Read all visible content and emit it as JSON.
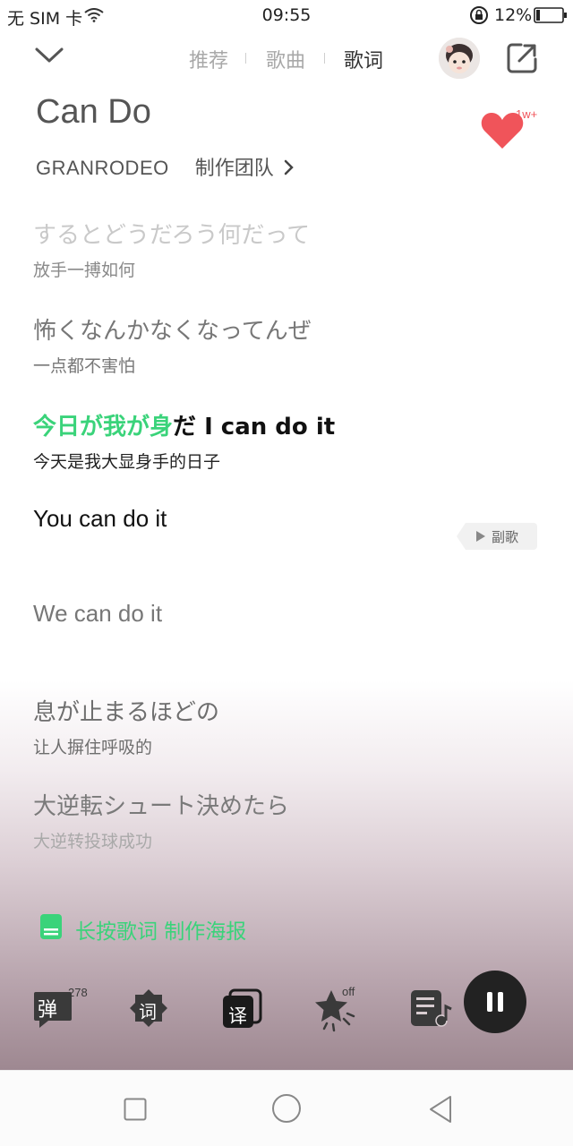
{
  "status_bar": {
    "carrier": "无 SIM 卡",
    "time": "09:55",
    "battery_percent": "12%"
  },
  "header": {
    "tabs": [
      {
        "label": "推荐",
        "active": false
      },
      {
        "label": "歌曲",
        "active": false
      },
      {
        "label": "歌词",
        "active": true
      }
    ]
  },
  "song": {
    "title": "Can Do",
    "artist": "GRANRODEO",
    "team": "制作团队",
    "like_count": "1w+"
  },
  "lyrics": [
    {
      "original": "するとどうだろう何だって",
      "translation": "放手一搏如何"
    },
    {
      "original": "怖くなんかなくなってんぜ",
      "translation": "一点都不害怕"
    },
    {
      "original_highlighted": "今日が我が身",
      "original_rest": "だ I can do it",
      "translation": "今天是我大显身手的日子"
    },
    {
      "original": "You can do it",
      "translation": ""
    },
    {
      "original": "We can do it",
      "translation": ""
    },
    {
      "original": "息が止まるほどの",
      "translation": "让人摒住呼吸的"
    },
    {
      "original": "大逆転シュート決めたら",
      "translation": "大逆转投球成功"
    }
  ],
  "chorus_badge": "副歌",
  "poster_action": "长按歌词 制作海报",
  "toolbar": {
    "danmaku_label": "弹",
    "danmaku_count": "278",
    "lyrics_label": "词",
    "translate_label": "译",
    "star_state": "off"
  },
  "colors": {
    "accent_green": "#3ad37a",
    "heart_red": "#f0545a",
    "play_button": "#222222"
  },
  "icons": [
    "chevron-down-icon",
    "share-icon",
    "heart-icon",
    "poster-icon",
    "danmaku-icon",
    "lyrics-icon",
    "translate-icon",
    "star-icon",
    "playlist-icon",
    "pause-icon"
  ]
}
